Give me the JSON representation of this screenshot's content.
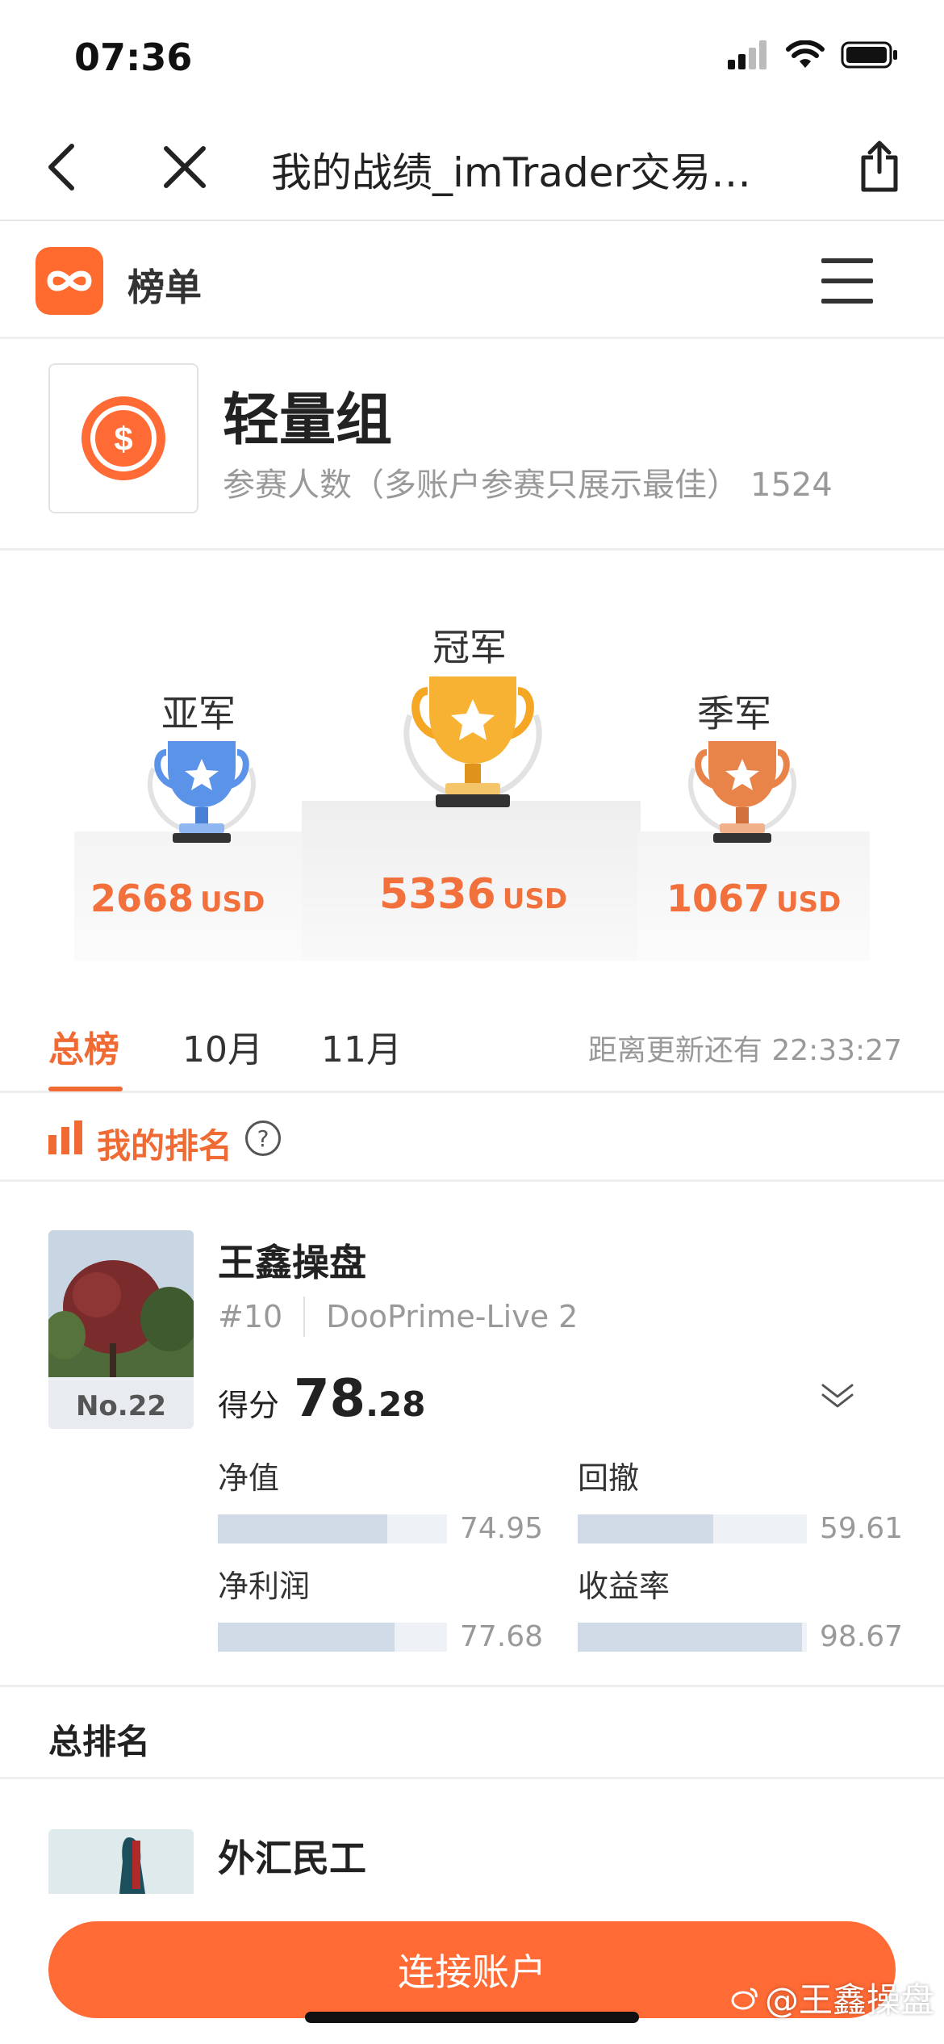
{
  "status_bar": {
    "time": "07:36"
  },
  "browser": {
    "title": "我的战绩_imTrader交易…"
  },
  "site": {
    "name": "榜单"
  },
  "group": {
    "title": "轻量组",
    "subtitle": "参赛人数（多账户参赛只展示最佳）",
    "participants": "1524"
  },
  "podium": {
    "second": {
      "label": "亚军",
      "amount": "2668",
      "unit": "USD"
    },
    "first": {
      "label": "冠军",
      "amount": "5336",
      "unit": "USD"
    },
    "third": {
      "label": "季军",
      "amount": "1067",
      "unit": "USD"
    }
  },
  "tabs": {
    "items": [
      {
        "label": "总榜",
        "active": true
      },
      {
        "label": "10月",
        "active": false
      },
      {
        "label": "11月",
        "active": false
      }
    ],
    "countdown_label": "距离更新还有",
    "countdown": "22:33:27"
  },
  "my_rank": {
    "title": "我的排名",
    "help": "?",
    "name": "王鑫操盘",
    "rank_badge": "No.22",
    "number": "#10",
    "server": "DooPrime-Live 2",
    "score_label": "得分",
    "score_int": "78",
    "score_dec": ".28",
    "metrics": [
      {
        "label": "净值",
        "value": "74.95",
        "fill": 0.74
      },
      {
        "label": "回撤",
        "value": "59.61",
        "fill": 0.59
      },
      {
        "label": "净利润",
        "value": "77.68",
        "fill": 0.77
      },
      {
        "label": "收益率",
        "value": "98.67",
        "fill": 0.98
      }
    ]
  },
  "total_rank": {
    "title": "总排名",
    "items": [
      {
        "name": "外汇民工"
      }
    ]
  },
  "bottom": {
    "connect_label": "连接账户",
    "watermark": "@王鑫操盘"
  },
  "colors": {
    "accent": "#f06a34",
    "button": "#ff6a35",
    "silver_cup": "#5b93e8",
    "gold_cup": "#f5a623",
    "bronze_cup": "#e8844a"
  }
}
